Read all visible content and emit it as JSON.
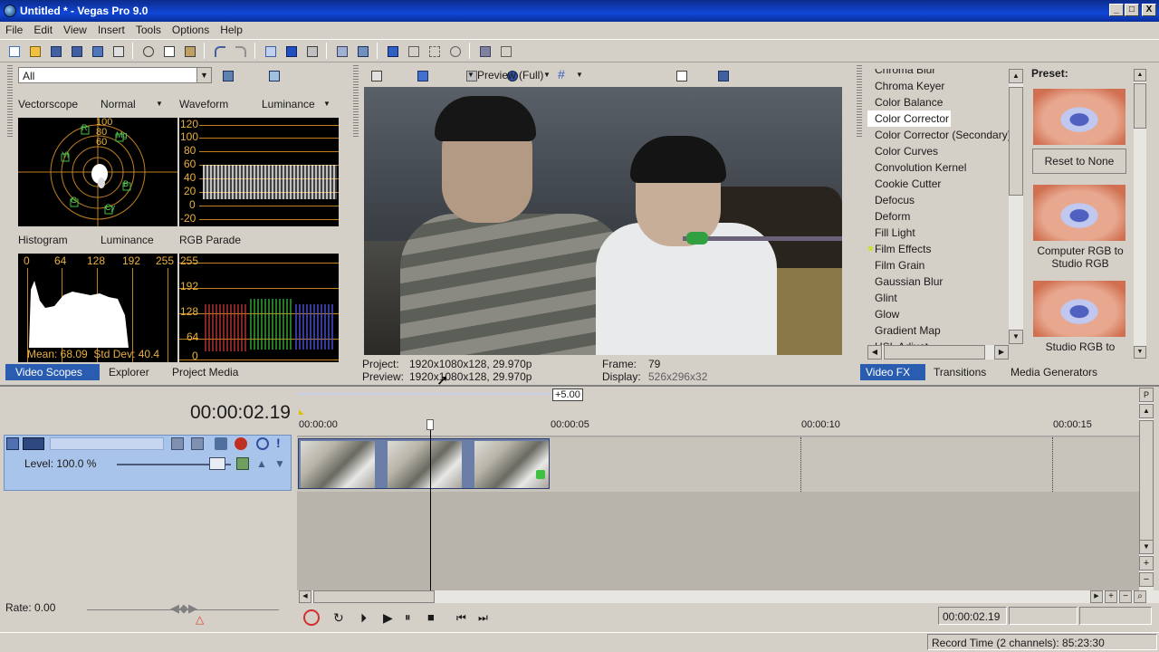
{
  "window": {
    "title": "Untitled * - Vegas Pro 9.0",
    "min_label": "_",
    "max_label": "□",
    "close_label": "X"
  },
  "menu": [
    "File",
    "Edit",
    "View",
    "Insert",
    "Tools",
    "Options",
    "Help"
  ],
  "scopes": {
    "filter_value": "All",
    "vectorscope_label": "Vectorscope",
    "vectorscope_mode": "Normal",
    "waveform_label": "Waveform",
    "waveform_mode": "Luminance",
    "waveform_ticks": [
      "120",
      "100",
      "80",
      "60",
      "40",
      "20",
      "0",
      "-20"
    ],
    "vectorscope_ticks": [
      "100",
      "80",
      "60"
    ],
    "vectorscope_letters": [
      "R",
      "Mg",
      "Yl",
      "B",
      "G",
      "Cy"
    ],
    "histogram_label": "Histogram",
    "histogram_mode": "Luminance",
    "histogram_ticks": [
      "0",
      "64",
      "128",
      "192",
      "255"
    ],
    "histogram_stats": "Mean: 68.09  Std Dev: 40.4",
    "parade_label": "RGB Parade",
    "parade_ticks": [
      "255",
      "192",
      "128",
      "64",
      "0"
    ],
    "tabs": [
      "Video Scopes",
      "Explorer",
      "Project Media"
    ]
  },
  "preview": {
    "quality": "Preview (Full)",
    "project_label": "Project:",
    "project_value": "1920x1080x128, 29.970p",
    "preview_label": "Preview:",
    "preview_value": "1920x1080x128, 29.970p",
    "frame_label": "Frame:",
    "frame_value": "79",
    "display_label": "Display:",
    "display_value": "526x296x32"
  },
  "fx": {
    "items": [
      "Chroma Blur",
      "Chroma Keyer",
      "Color Balance",
      "Color Corrector",
      "Color Corrector (Secondary)",
      "Color Curves",
      "Convolution Kernel",
      "Cookie Cutter",
      "Defocus",
      "Deform",
      "Fill Light",
      "Film Effects",
      "Film Grain",
      "Gaussian Blur",
      "Glint",
      "Glow",
      "Gradient Map",
      "HSL Adjust"
    ],
    "selected": "Color Corrector",
    "preset_label": "Preset:",
    "presets": [
      "Reset to None",
      "Computer RGB to Studio RGB",
      "Studio RGB to"
    ],
    "tabs": [
      "Video FX",
      "Transitions",
      "Media Generators"
    ]
  },
  "timeline": {
    "timecode": "00:00:02.19",
    "offset_badge": "+5.00",
    "ruler": [
      "00:00:00",
      "00:00:05",
      "00:00:10",
      "00:00:15"
    ],
    "track_level": "Level: 100.0 %",
    "rate": "Rate: 0.00",
    "status_timecode": "00:00:02.19",
    "record_time": "Record Time (2 channels): 85:23:30"
  },
  "colors": {
    "title_bar": "#1046d8",
    "track_header": "#a9c4ea",
    "scope_grid": "#c08020"
  }
}
